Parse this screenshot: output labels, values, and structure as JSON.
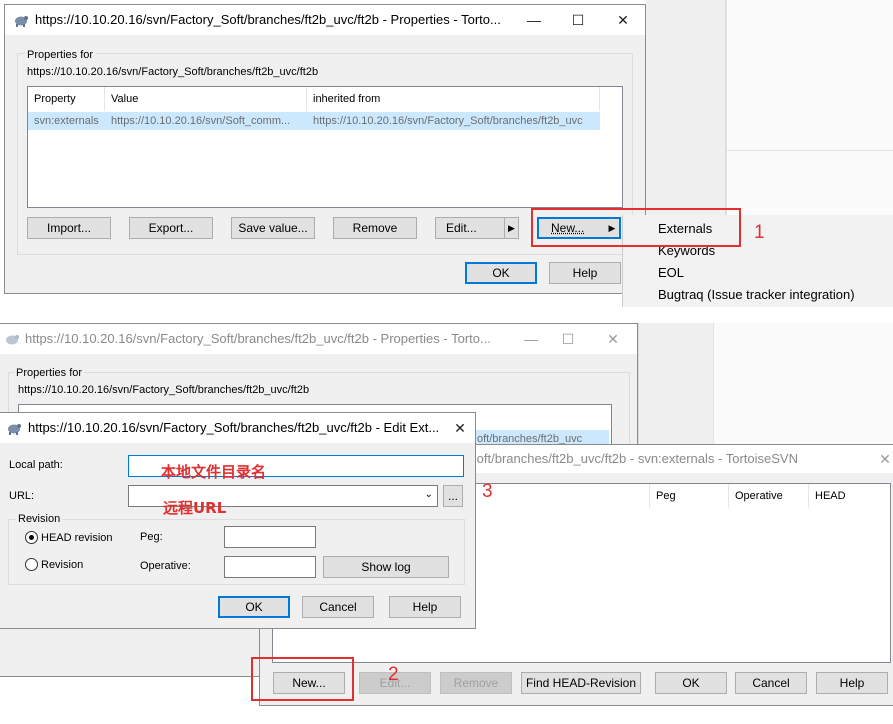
{
  "top_window": {
    "title": "https://10.10.20.16/svn/Factory_Soft/branches/ft2b_uvc/ft2b - Properties - Torto...",
    "properties_for_label": "Properties for",
    "path": "https://10.10.20.16/svn/Factory_Soft/branches/ft2b_uvc/ft2b",
    "columns": [
      "Property",
      "Value",
      "inherited from"
    ],
    "row": {
      "property": "svn:externals",
      "value": "https://10.10.20.16/svn/Soft_comm...",
      "inherited_from": "https://10.10.20.16/svn/Factory_Soft/branches/ft2b_uvc"
    },
    "buttons": {
      "import": "Import...",
      "export": "Export...",
      "save_value": "Save value...",
      "remove": "Remove",
      "edit": "Edit...",
      "new": "New...",
      "ok": "OK",
      "help": "Help"
    },
    "new_menu": [
      "Externals",
      "Keywords",
      "EOL",
      "Bugtraq (Issue tracker integration)"
    ]
  },
  "bottom_props_window": {
    "title": "https://10.10.20.16/svn/Factory_Soft/branches/ft2b_uvc/ft2b - Properties - Torto...",
    "properties_for_label": "Properties for",
    "path": "https://10.10.20.16/svn/Factory_Soft/branches/ft2b_uvc/ft2b",
    "list_fragment": "oft/branches/ft2b_uvc"
  },
  "externals_window": {
    "title": "Soft/branches/ft2b_uvc/ft2b - svn:externals - TortoiseSVN",
    "columns": [
      "Peg",
      "Operative",
      "HEAD"
    ],
    "buttons": {
      "new": "New...",
      "edit": "Edit...",
      "remove": "Remove",
      "find_head": "Find HEAD-Revision",
      "ok": "OK",
      "cancel": "Cancel",
      "help": "Help"
    }
  },
  "edit_dialog": {
    "title": "https://10.10.20.16/svn/Factory_Soft/branches/ft2b_uvc/ft2b - Edit Ext...",
    "local_path_label": "Local path:",
    "url_label": "URL:",
    "browse_label": "...",
    "revision_group": "Revision",
    "head_revision": "HEAD revision",
    "revision": "Revision",
    "peg_label": "Peg:",
    "operative_label": "Operative:",
    "show_log": "Show log",
    "ok": "OK",
    "cancel": "Cancel",
    "help": "Help"
  },
  "annotations": {
    "num1": "1",
    "num2": "2",
    "num3": "3",
    "local_path_hint": "本地文件目录名",
    "url_hint": "远程URL"
  },
  "colors": {
    "annotation_red": "#e03030",
    "selection": "#cce8ff",
    "default_button_border": "#0078d7"
  }
}
